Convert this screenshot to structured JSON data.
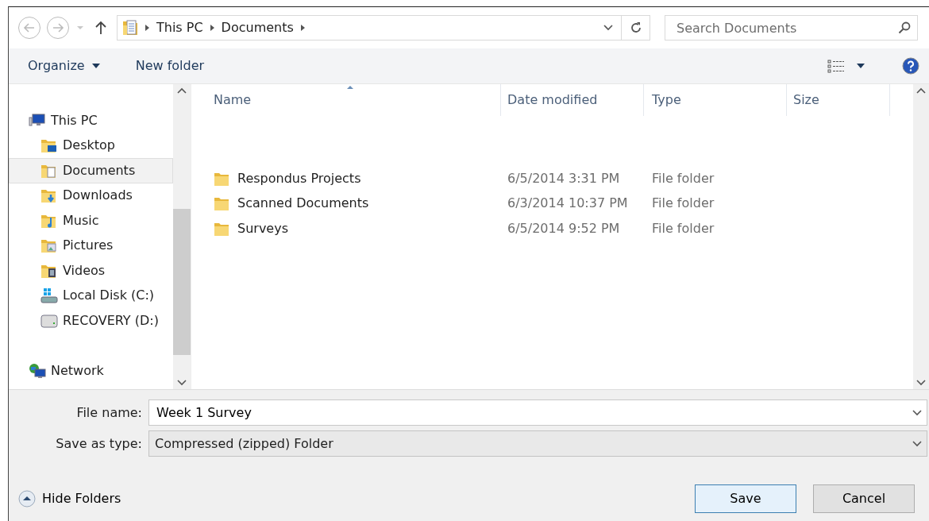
{
  "navigation": {
    "back": {
      "disabled": true
    },
    "forward": {
      "disabled": true
    }
  },
  "address": {
    "breadcrumbs": [
      "This PC",
      "Documents"
    ]
  },
  "search": {
    "placeholder": "Search Documents"
  },
  "toolbar": {
    "organize": "Organize",
    "new_folder": "New folder"
  },
  "sidebar": {
    "items": [
      {
        "label": "This PC",
        "kind": "pc",
        "selected": false,
        "children": [
          {
            "label": "Desktop",
            "kind": "desktop",
            "selected": false
          },
          {
            "label": "Documents",
            "kind": "documents",
            "selected": true
          },
          {
            "label": "Downloads",
            "kind": "downloads",
            "selected": false
          },
          {
            "label": "Music",
            "kind": "music",
            "selected": false
          },
          {
            "label": "Pictures",
            "kind": "pictures",
            "selected": false
          },
          {
            "label": "Videos",
            "kind": "videos",
            "selected": false
          },
          {
            "label": "Local Disk (C:)",
            "kind": "system-drive",
            "selected": false
          },
          {
            "label": "RECOVERY (D:)",
            "kind": "drive",
            "selected": false
          }
        ]
      },
      {
        "label": "Network",
        "kind": "network",
        "selected": false
      }
    ]
  },
  "table": {
    "columns": [
      {
        "label": "Name",
        "sorted": true
      },
      {
        "label": "Date modified",
        "sorted": false
      },
      {
        "label": "Type",
        "sorted": false
      },
      {
        "label": "Size",
        "sorted": false
      }
    ],
    "rows": [
      {
        "name": "Respondus Projects",
        "date": "6/5/2014 3:31 PM",
        "type": "File folder"
      },
      {
        "name": "Scanned Documents",
        "date": "6/3/2014 10:37 PM",
        "type": "File folder"
      },
      {
        "name": "Surveys",
        "date": "6/5/2014 9:52 PM",
        "type": "File folder"
      }
    ]
  },
  "file_name": {
    "label": "File name:",
    "value": "Week 1 Survey"
  },
  "save_as_type": {
    "label": "Save as type:",
    "value": "Compressed (zipped) Folder"
  },
  "hide_folders": "Hide Folders",
  "buttons": [
    {
      "label": "Save",
      "default": true
    },
    {
      "label": "Cancel",
      "default": false
    }
  ]
}
